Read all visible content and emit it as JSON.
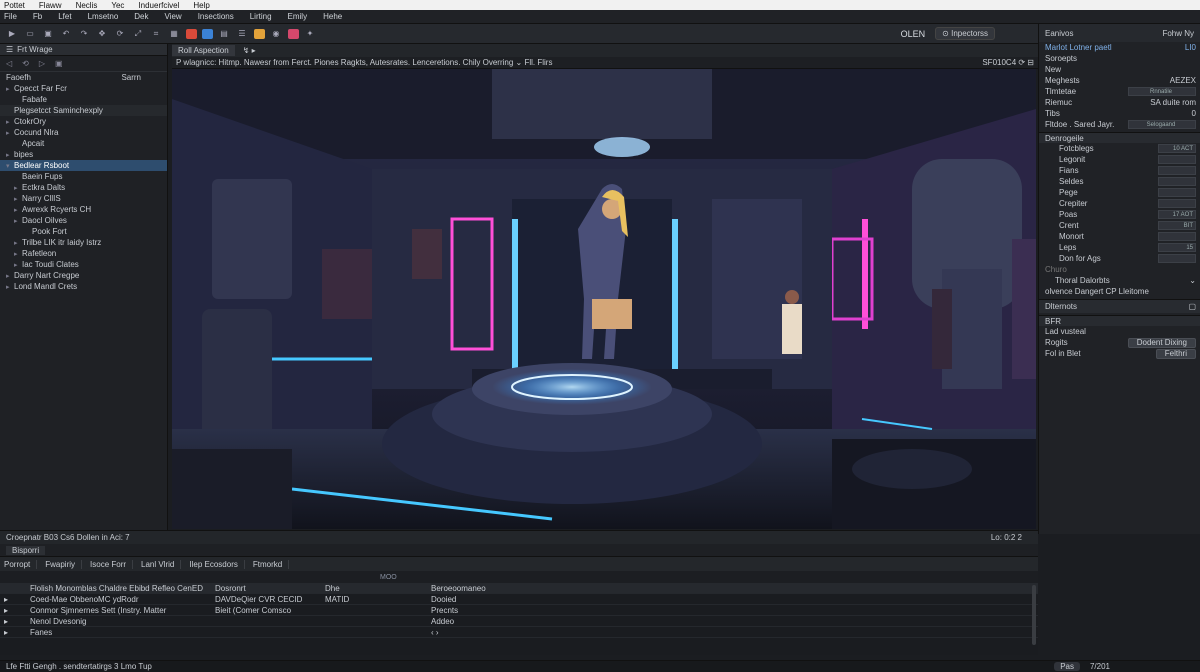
{
  "titlebar": [
    "Pottet",
    "Flaww",
    "Neclis",
    "Yec",
    "Induerfcivel",
    "Help"
  ],
  "menubar": [
    "File",
    "Fb",
    "Lfet",
    "Lmsetno",
    "Dek",
    "View",
    "Insections",
    "Lirting",
    "Emily",
    "Hehe"
  ],
  "toolbar": {
    "swatches": [
      "#d94a3a",
      "#3b82d6",
      "#e2a23a",
      "#d4486c"
    ],
    "right_label": "OLEN",
    "inspector_btn": "Inpectorss"
  },
  "left": {
    "tab": "Frt Wrage",
    "header_left": "Faoefh",
    "header_right": "Sarrn",
    "rows": [
      {
        "t": "Cpecct Far Fcr",
        "lvl": 0,
        "caret": "▸"
      },
      {
        "t": "Fabafe",
        "lvl": 1,
        "caret": ""
      },
      {
        "t": "Plegsetcct Saminchexply",
        "lvl": 0,
        "caret": "",
        "header": true
      },
      {
        "t": "CtokrOry",
        "lvl": 0,
        "caret": "▸"
      },
      {
        "t": "Cocund Nlra",
        "lvl": 0,
        "caret": "▸"
      },
      {
        "t": "Apcait",
        "lvl": 1,
        "caret": ""
      },
      {
        "t": "bipes",
        "lvl": 0,
        "caret": "▸"
      },
      {
        "t": "Bedlear Rsboot",
        "lvl": 0,
        "caret": "▾",
        "sel": true
      },
      {
        "t": "Baein Fups",
        "lvl": 1,
        "caret": ""
      },
      {
        "t": "Ectkra Dalts",
        "lvl": 1,
        "caret": "▸"
      },
      {
        "t": "Narry CllIS",
        "lvl": 1,
        "caret": "▸"
      },
      {
        "t": "Awrexk Rcyerts CH",
        "lvl": 1,
        "caret": "▸"
      },
      {
        "t": "Daocl Oilves",
        "lvl": 1,
        "caret": "▸"
      },
      {
        "t": "Pook Fort",
        "lvl": 2,
        "caret": ""
      },
      {
        "t": "Trilbe LIK itr Iaidy Istrz",
        "lvl": 1,
        "caret": "▸"
      },
      {
        "t": "Rafetleon",
        "lvl": 1,
        "caret": "▸"
      },
      {
        "t": "Iac Toudi Clates",
        "lvl": 1,
        "caret": "▸"
      },
      {
        "t": "Darry Nart Cregpe",
        "lvl": 0,
        "caret": "▸"
      },
      {
        "t": "Lond Mandl Crets",
        "lvl": 0,
        "caret": "▸"
      }
    ]
  },
  "viewport": {
    "tab": "Roll Aspection",
    "controls": "↯ ▸",
    "bar_left": "P wlagnicc: Hitmp. Nawesr from Ferct. Piones Ragkts, Autesrates. Lenceretions. Chily Overring  ⌄  Fll. Flirs",
    "bar_right": "SF010C4 ⟳ ⊟"
  },
  "inspector": {
    "head_left": "Eanivos",
    "head_right": "Fohw Ny",
    "sub_left": "Marlot Lotner paetl",
    "sub_right": "LI0",
    "rows": [
      {
        "l": "Soroepts",
        "v": ""
      },
      {
        "l": "New",
        "v": ""
      },
      {
        "l": "Meghests",
        "v": "AEZEX"
      },
      {
        "l": "Tlmtetae",
        "v": "Rnnatile",
        "field": true
      },
      {
        "l": "Riemuc",
        "v": "SA duite rom"
      },
      {
        "l": "Tibs",
        "v": "0"
      },
      {
        "l": "Fltdoe . Sared Jayr.",
        "v": "Selogaand",
        "field": true
      }
    ],
    "section": "Denrogeile",
    "props": [
      {
        "l": "Fotcblegs",
        "v": "10 ACT"
      },
      {
        "l": "Legonit",
        "v": ""
      },
      {
        "l": "Fians",
        "v": ""
      },
      {
        "l": "Seldes",
        "v": ""
      },
      {
        "l": "Pege",
        "v": ""
      },
      {
        "l": "Crepiter",
        "v": ""
      },
      {
        "l": "Poas",
        "v": "17 AOT"
      },
      {
        "l": "Crent",
        "v": "BIT"
      },
      {
        "l": "Monort",
        "v": ""
      },
      {
        "l": "Leps",
        "v": "15"
      },
      {
        "l": "Don for Ags",
        "v": ""
      }
    ],
    "chure": "Churo",
    "thoral": "Thoral Dalorbts",
    "ofence": "olvence Dangert CP Lleitome",
    "internets": "Dlternots",
    "bfr": "BFR",
    "lad": "Lad vusteal",
    "rogis_label": "Rogits",
    "rogis_btn": "Dodent Dixing",
    "fol_label": "Fol in Blet",
    "fol_btn": "Felthri"
  },
  "bottom": {
    "status_left": "Croepnatr B03     Cs6 Dollen  in Aci: 7",
    "status_right": "Lo: 0:2  2",
    "tab": "Bisporri",
    "tools": [
      "Porropt",
      "Fwapiriy",
      "Isoce Forr",
      "Lanl Vlrid",
      "Ilep Ecosdors",
      "Ftmorkd"
    ],
    "filters": [
      "MOO"
    ],
    "columns": [
      "Flolish Monomblas Chaldre Ebibd Refleo CenED",
      "Dosronrt",
      "Dhe",
      "Beroeoomaneo"
    ],
    "rows": [
      [
        "Coed-Mae ObbenoMC ydRodr",
        "DAVDeQier CVR CECID",
        "MATID",
        "Dooied"
      ],
      [
        "Conmor Sjmnernes Sett (Instry. Matter",
        "Bieit (Comer Comsco",
        "",
        "Precnts"
      ],
      [
        "Nenol Dvesonig",
        "",
        "",
        "Addeo"
      ],
      [
        "Fanes",
        "",
        "",
        "‹  ›"
      ]
    ]
  },
  "statusbar": {
    "left": "Lfe Ftti Gengh . sendtertatirgs 3 Lmo Tup",
    "right": "7/201",
    "pill": "Pas"
  }
}
